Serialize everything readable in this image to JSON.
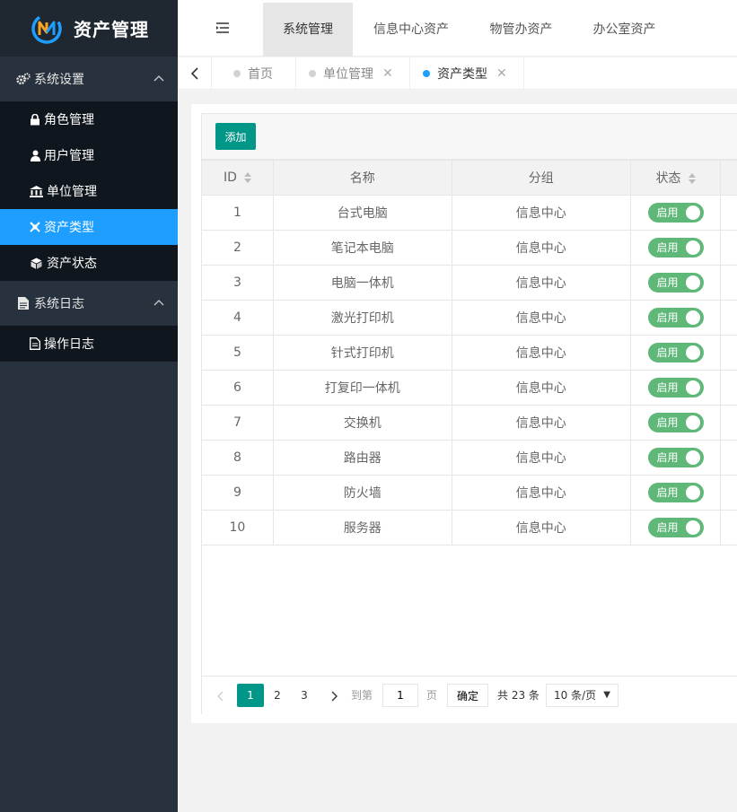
{
  "app": {
    "title": "资产管理"
  },
  "colors": {
    "accent": "#1e9fff",
    "primary": "#009688",
    "switch_on": "#5fb878",
    "sidebar": "#28323e"
  },
  "sidebar": {
    "groups": [
      {
        "label": "系统设置",
        "icon": "gears-icon",
        "items": [
          {
            "label": "角色管理",
            "icon": "lock-icon"
          },
          {
            "label": "用户管理",
            "icon": "user-icon"
          },
          {
            "label": "单位管理",
            "icon": "bank-icon"
          },
          {
            "label": "资产类型",
            "icon": "cross-icon",
            "active": true
          },
          {
            "label": "资产状态",
            "icon": "cube-icon"
          }
        ]
      },
      {
        "label": "系统日志",
        "icon": "file-icon",
        "items": [
          {
            "label": "操作日志",
            "icon": "file-outline-icon"
          }
        ]
      }
    ]
  },
  "header": {
    "tabs": [
      {
        "label": "系统管理",
        "active": true
      },
      {
        "label": "信息中心资产"
      },
      {
        "label": "物管办资产"
      },
      {
        "label": "办公室资产"
      }
    ]
  },
  "pagetabs": [
    {
      "label": "首页",
      "closable": false
    },
    {
      "label": "单位管理",
      "closable": true
    },
    {
      "label": "资产类型",
      "closable": true,
      "active": true
    }
  ],
  "toolbar": {
    "add_label": "添加"
  },
  "table": {
    "columns": [
      "ID",
      "名称",
      "分组",
      "状态"
    ],
    "switch_label": "启用",
    "rows": [
      {
        "id": "1",
        "name": "台式电脑",
        "group": "信息中心",
        "status": "启用"
      },
      {
        "id": "2",
        "name": "笔记本电脑",
        "group": "信息中心",
        "status": "启用"
      },
      {
        "id": "3",
        "name": "电脑一体机",
        "group": "信息中心",
        "status": "启用"
      },
      {
        "id": "4",
        "name": "激光打印机",
        "group": "信息中心",
        "status": "启用"
      },
      {
        "id": "5",
        "name": "针式打印机",
        "group": "信息中心",
        "status": "启用"
      },
      {
        "id": "6",
        "name": "打复印一体机",
        "group": "信息中心",
        "status": "启用"
      },
      {
        "id": "7",
        "name": "交换机",
        "group": "信息中心",
        "status": "启用"
      },
      {
        "id": "8",
        "name": "路由器",
        "group": "信息中心",
        "status": "启用"
      },
      {
        "id": "9",
        "name": "防火墙",
        "group": "信息中心",
        "status": "启用"
      },
      {
        "id": "10",
        "name": "服务器",
        "group": "信息中心",
        "status": "启用"
      }
    ]
  },
  "pager": {
    "pages": [
      "1",
      "2",
      "3"
    ],
    "current": "1",
    "goto_label": "到第",
    "goto_value": "1",
    "page_unit": "页",
    "confirm_label": "确定",
    "total_label": "共 23 条",
    "page_size": "10 条/页"
  }
}
